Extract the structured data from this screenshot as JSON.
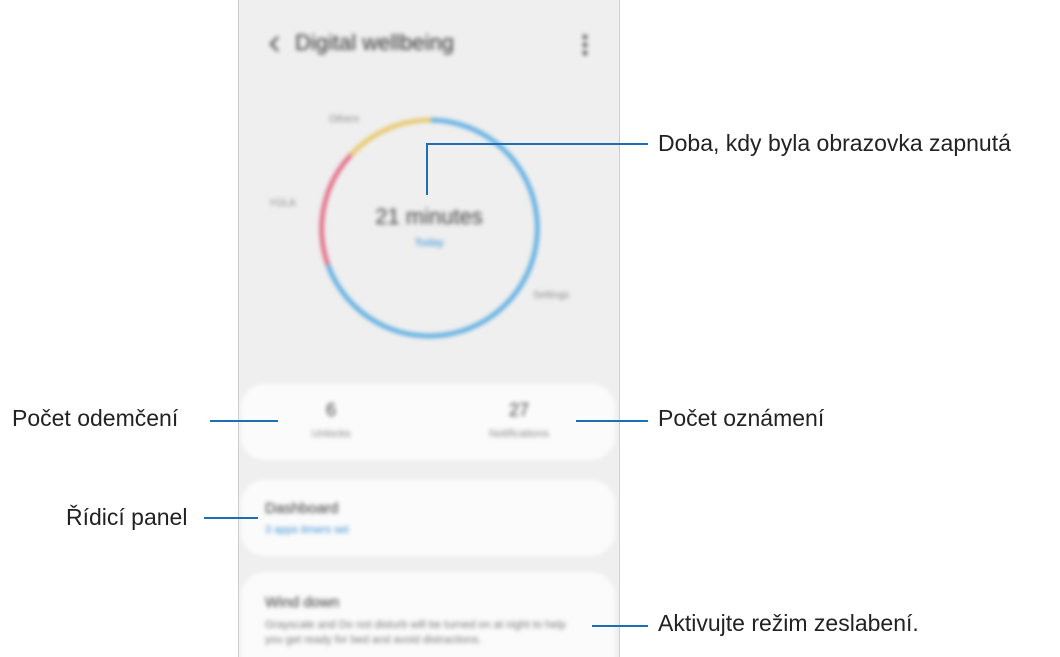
{
  "app": {
    "title": "Digital wellbeing",
    "back_icon": "chevron-left-icon",
    "more_icon": "more-vertical-icon"
  },
  "ring": {
    "label_top": "Others",
    "label_left": "YOLA",
    "label_right": "Settings",
    "colors": {
      "main": "#4aa5e0",
      "secondary": "#e6c35a",
      "tertiary": "#e05a78"
    }
  },
  "screen_time": {
    "value": "21 minutes",
    "label": "Today"
  },
  "stats": {
    "unlocks": {
      "value": "6",
      "label": "Unlocks"
    },
    "notifications": {
      "value": "27",
      "label": "Notifications"
    }
  },
  "dashboard": {
    "title": "Dashboard",
    "subtitle": "3 apps timers set"
  },
  "wind_down": {
    "title": "Wind down",
    "description": "Grayscale and Do not disturb will be turned on at night to help you get ready for bed and avoid distractions."
  },
  "callouts": {
    "screen_on_time": "Doba, kdy byla obrazovka zapnutá",
    "unlock_count": "Počet odemčení",
    "notification_count": "Počet oznámení",
    "dashboard": "Řídicí panel",
    "wind_down": "Aktivujte režim zeslabení."
  }
}
